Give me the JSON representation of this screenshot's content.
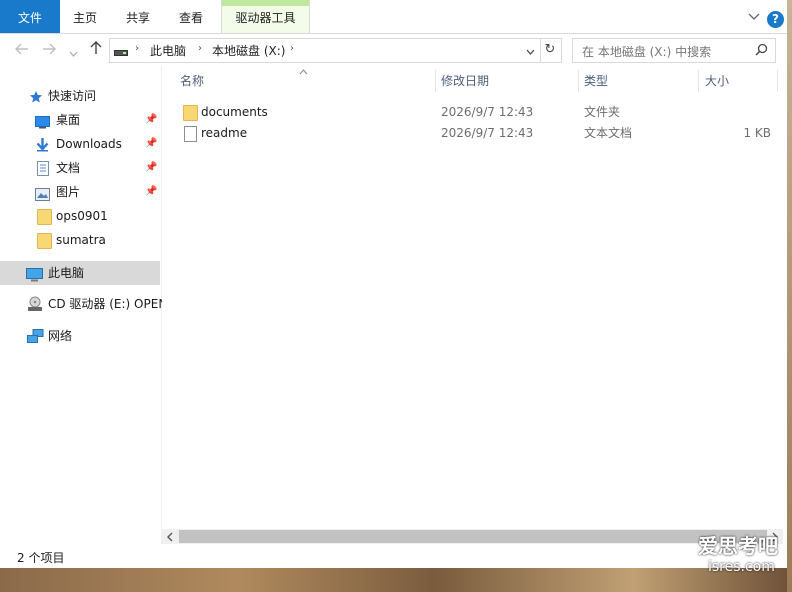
{
  "ribbon": {
    "tabs": [
      {
        "label": "文件",
        "name": "tab-file"
      },
      {
        "label": "主页",
        "name": "tab-home"
      },
      {
        "label": "共享",
        "name": "tab-share"
      },
      {
        "label": "查看",
        "name": "tab-view"
      },
      {
        "label": "驱动器工具",
        "name": "tab-drive-tools"
      }
    ],
    "help_label": "?"
  },
  "address": {
    "segments": [
      "此电脑",
      "本地磁盘 (X:)"
    ]
  },
  "search": {
    "placeholder": "在 本地磁盘 (X:) 中搜索"
  },
  "sidebar": {
    "quick_access": "快速访问",
    "items": [
      {
        "label": "桌面",
        "pinned": true
      },
      {
        "label": "Downloads",
        "pinned": true
      },
      {
        "label": "文档",
        "pinned": true
      },
      {
        "label": "图片",
        "pinned": true
      },
      {
        "label": "ops0901",
        "pinned": false
      },
      {
        "label": "sumatra",
        "pinned": false
      }
    ],
    "this_pc": "此电脑",
    "cd_drive": "CD 驱动器 (E:) OPEN",
    "network": "网络"
  },
  "columns": {
    "name": "名称",
    "modified": "修改日期",
    "type": "类型",
    "size": "大小"
  },
  "files": [
    {
      "name": "documents",
      "modified": "2026/9/7 12:43",
      "type": "文件夹",
      "size": "",
      "kind": "folder"
    },
    {
      "name": "readme",
      "modified": "2026/9/7 12:43",
      "type": "文本文档",
      "size": "1 KB",
      "kind": "file"
    }
  ],
  "status": {
    "item_count": "2 个项目"
  },
  "watermark": {
    "line1": "爱思考吧",
    "line2": "isres.com"
  }
}
